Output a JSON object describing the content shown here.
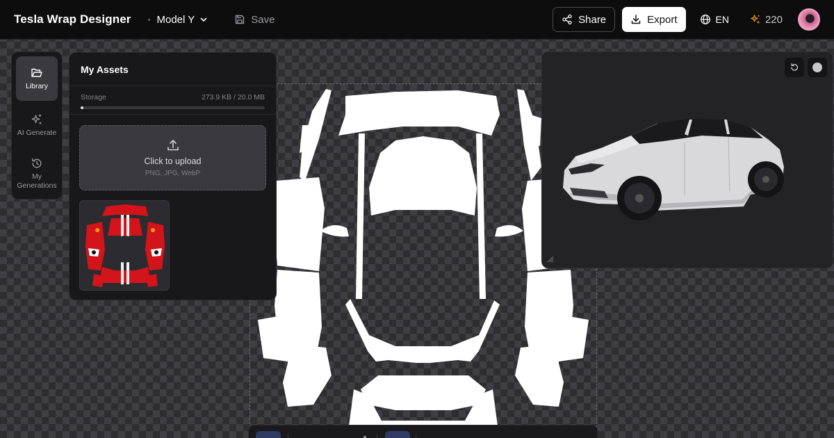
{
  "header": {
    "app_title": "Tesla Wrap Designer",
    "model": "Model Y",
    "save_label": "Save",
    "share_label": "Share",
    "export_label": "Export",
    "language": "EN",
    "credits": "220"
  },
  "sidebar": {
    "items": [
      {
        "label": "Library",
        "icon": "folder-open-icon",
        "active": true
      },
      {
        "label": "AI Generate",
        "icon": "sparkles-icon",
        "active": false
      },
      {
        "label": "My Generations",
        "icon": "history-icon",
        "active": false
      }
    ]
  },
  "assets": {
    "title": "My Assets",
    "storage_label": "Storage",
    "storage_used": "273.9 KB / 20.0 MB",
    "storage_fraction": 0.0134,
    "upload_label": "Click to upload",
    "upload_hint": "PNG, JPG, WebP",
    "items": [
      {
        "kind": "red racing wrap texture"
      }
    ]
  },
  "preview": {
    "reset_icon": "rotate-ccw-icon",
    "background_icon": "circle-icon",
    "car": "white Tesla Model Y render"
  },
  "colors": {
    "topbar_bg": "#0d0d0e",
    "panel_bg": "#18181b",
    "accent_export": "#ffffff",
    "credits_icon": "#f59e0b",
    "wrap_red": "#d4141b"
  }
}
